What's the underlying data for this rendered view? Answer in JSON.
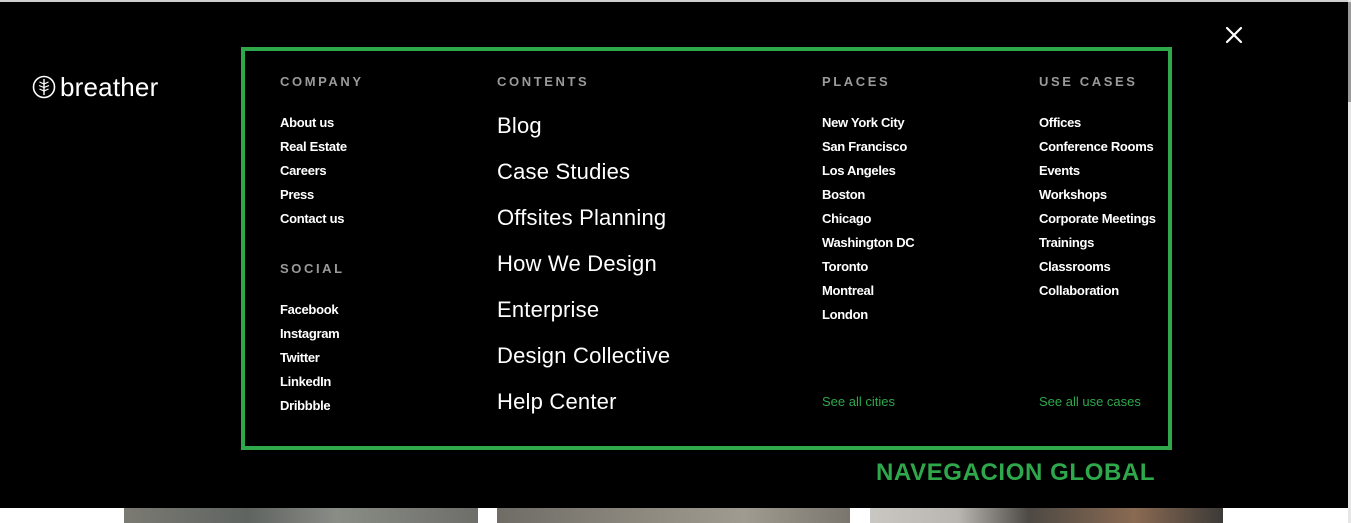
{
  "brand": {
    "name": "breather"
  },
  "menu": {
    "company": {
      "heading": "COMPANY",
      "items": [
        "About us",
        "Real Estate",
        "Careers",
        "Press",
        "Contact us"
      ]
    },
    "social": {
      "heading": "SOCIAL",
      "items": [
        "Facebook",
        "Instagram",
        "Twitter",
        "LinkedIn",
        "Dribbble"
      ]
    },
    "contents": {
      "heading": "CONTENTS",
      "items": [
        "Blog",
        "Case Studies",
        "Offsites Planning",
        "How We Design",
        "Enterprise",
        "Design Collective",
        "Help Center"
      ]
    },
    "places": {
      "heading": "PLACES",
      "items": [
        "New York City",
        "San Francisco",
        "Los Angeles",
        "Boston",
        "Chicago",
        "Washington DC",
        "Toronto",
        "Montreal",
        "London"
      ],
      "see_all": "See all cities"
    },
    "use_cases": {
      "heading": "USE CASES",
      "items": [
        "Offices",
        "Conference Rooms",
        "Events",
        "Workshops",
        "Corporate Meetings",
        "Trainings",
        "Classrooms",
        "Collaboration"
      ],
      "see_all": "See all use cases"
    }
  },
  "annotation": {
    "label": "NAVEGACION GLOBAL"
  },
  "icons": {
    "logo": "breather-leaf-icon",
    "close": "close-icon"
  },
  "colors": {
    "background": "#000000",
    "accent": "#2ea84a",
    "heading": "#9a9a9a",
    "text": "#ffffff"
  }
}
